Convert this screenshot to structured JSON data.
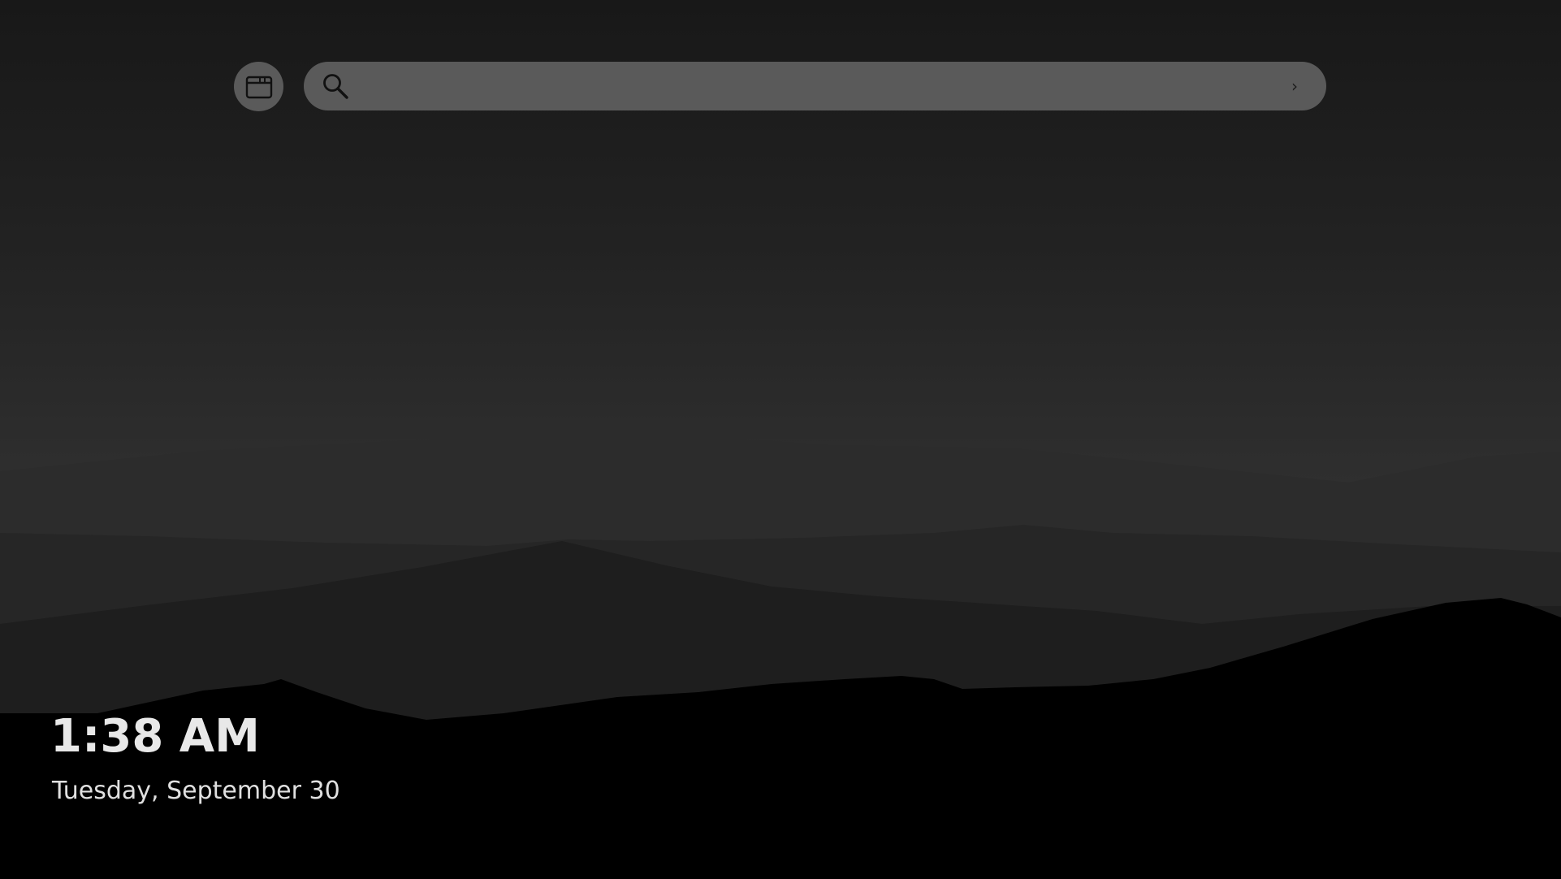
{
  "topbar": {
    "tab_button_icon": "browser-window-icon",
    "search": {
      "icon": "search-icon",
      "value": "",
      "placeholder": "",
      "submit_label": "›"
    }
  },
  "lockscreen": {
    "time": "1:38 AM",
    "date": "Tuesday, September 30"
  },
  "colors": {
    "search_bar": "#5a5a5a",
    "text": "#e8e8e8",
    "foreground_hills": "#000000"
  }
}
